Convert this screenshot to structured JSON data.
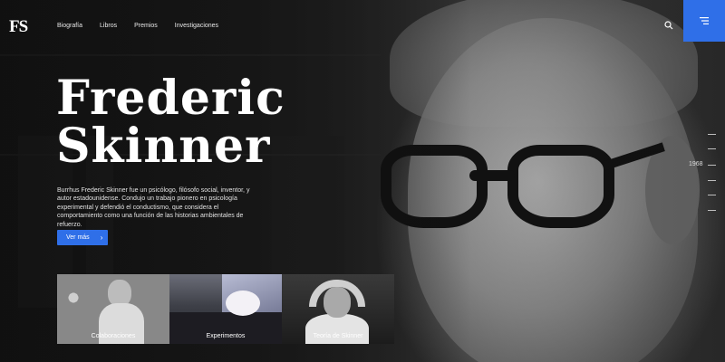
{
  "header": {
    "logo": "FS",
    "nav": [
      "Biografía",
      "Libros",
      "Premios",
      "Investigaciones"
    ]
  },
  "hero": {
    "title_line1": "Frederic",
    "title_line2": "Skinner",
    "description": "Burrhus Frederic Skinner fue un psicólogo, filósofo social, inventor, y autor estadounidense. Condujo un trabajo pionero en psicología experimental y defendió el conductismo, que considera el comportamiento como una función de las historias ambientales de refuerzo.",
    "cta_label": "Ver más"
  },
  "timeline": {
    "year": "1968"
  },
  "cards": [
    {
      "label": "Colaboraciones"
    },
    {
      "label": "Experimentos"
    },
    {
      "label": "Teoría de Skinner"
    }
  ],
  "colors": {
    "accent": "#2f6fe8",
    "background": "#1a1a1a",
    "text": "#ffffff"
  },
  "icons": {
    "search": "search-icon",
    "menu": "menu-icon",
    "cta_arrow": "chevron-right-icon"
  }
}
